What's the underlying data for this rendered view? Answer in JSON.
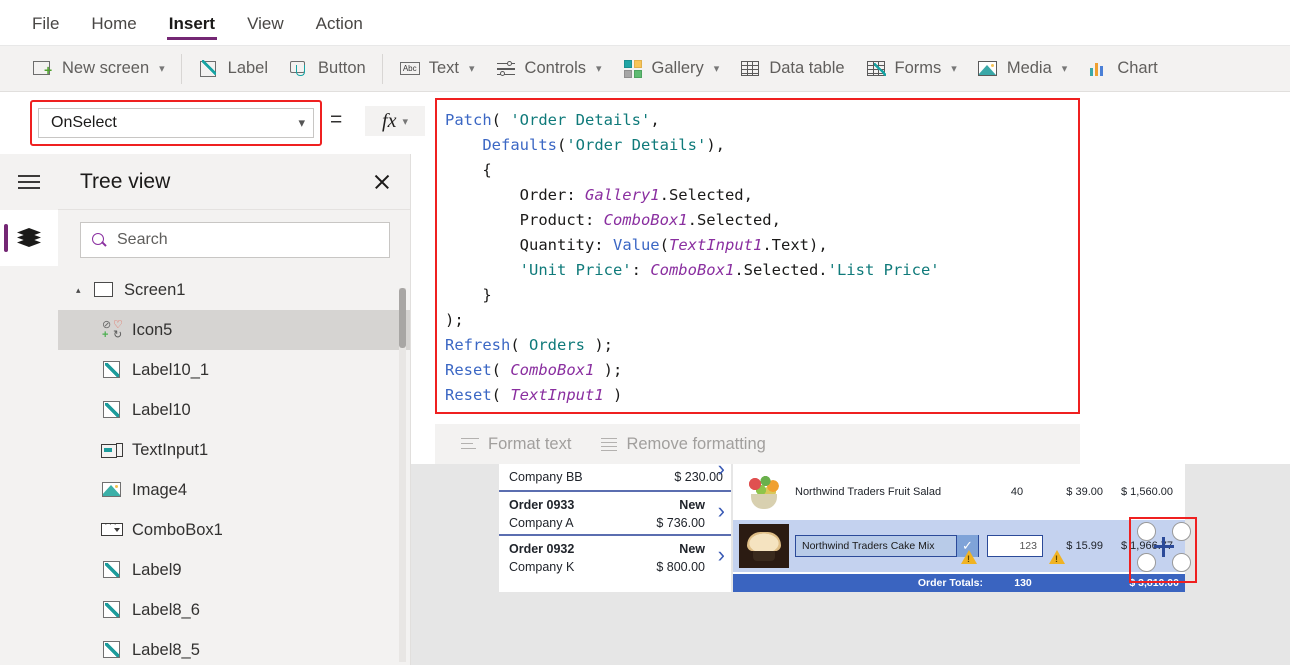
{
  "menu": {
    "items": [
      {
        "label": "File",
        "active": false
      },
      {
        "label": "Home",
        "active": false
      },
      {
        "label": "Insert",
        "active": true
      },
      {
        "label": "View",
        "active": false
      },
      {
        "label": "Action",
        "active": false
      }
    ]
  },
  "ribbon": {
    "items": [
      {
        "label": "New screen",
        "icon": "new-screen-icon",
        "chevron": true
      },
      {
        "label": "Label",
        "icon": "label-icon",
        "chevron": false
      },
      {
        "label": "Button",
        "icon": "button-icon",
        "chevron": false
      },
      {
        "label": "Text",
        "icon": "text-abc-icon",
        "chevron": true
      },
      {
        "label": "Controls",
        "icon": "controls-sliders-icon",
        "chevron": true
      },
      {
        "label": "Gallery",
        "icon": "gallery-icon",
        "chevron": true
      },
      {
        "label": "Data table",
        "icon": "data-table-icon",
        "chevron": false
      },
      {
        "label": "Forms",
        "icon": "forms-icon",
        "chevron": true
      },
      {
        "label": "Media",
        "icon": "media-image-icon",
        "chevron": true
      },
      {
        "label": "Chart",
        "icon": "chart-bar-icon",
        "chevron": false
      }
    ]
  },
  "property_bar": {
    "selected_property": "OnSelect",
    "equals": "=",
    "fx_label": "fx",
    "highlight_color": "#ef2020"
  },
  "formula": {
    "lines": [
      [
        {
          "t": "Patch",
          "c": "fn"
        },
        {
          "t": "( ",
          "c": "pun"
        },
        {
          "t": "'Order Details'",
          "c": "str"
        },
        {
          "t": ",",
          "c": "pun"
        }
      ],
      [
        {
          "t": "    ",
          "c": "pun"
        },
        {
          "t": "Defaults",
          "c": "fn"
        },
        {
          "t": "(",
          "c": "pun"
        },
        {
          "t": "'Order Details'",
          "c": "str"
        },
        {
          "t": "),",
          "c": "pun"
        }
      ],
      [
        {
          "t": "    {",
          "c": "pun"
        }
      ],
      [
        {
          "t": "        Order: ",
          "c": "id"
        },
        {
          "t": "Gallery1",
          "c": "var"
        },
        {
          "t": ".Selected,",
          "c": "id"
        }
      ],
      [
        {
          "t": "        Product: ",
          "c": "id"
        },
        {
          "t": "ComboBox1",
          "c": "var"
        },
        {
          "t": ".Selected,",
          "c": "id"
        }
      ],
      [
        {
          "t": "        Quantity: ",
          "c": "id"
        },
        {
          "t": "Value",
          "c": "fn"
        },
        {
          "t": "(",
          "c": "pun"
        },
        {
          "t": "TextInput1",
          "c": "var"
        },
        {
          "t": ".Text),",
          "c": "id"
        }
      ],
      [
        {
          "t": "        ",
          "c": "id"
        },
        {
          "t": "'Unit Price'",
          "c": "str"
        },
        {
          "t": ": ",
          "c": "id"
        },
        {
          "t": "ComboBox1",
          "c": "var"
        },
        {
          "t": ".Selected.",
          "c": "id"
        },
        {
          "t": "'List Price'",
          "c": "str"
        }
      ],
      [
        {
          "t": "    }",
          "c": "pun"
        }
      ],
      [
        {
          "t": ");",
          "c": "pun"
        }
      ],
      [
        {
          "t": "Refresh",
          "c": "fn"
        },
        {
          "t": "( ",
          "c": "pun"
        },
        {
          "t": "Orders",
          "c": "str"
        },
        {
          "t": " );",
          "c": "pun"
        }
      ],
      [
        {
          "t": "Reset",
          "c": "fn"
        },
        {
          "t": "( ",
          "c": "pun"
        },
        {
          "t": "ComboBox1",
          "c": "var"
        },
        {
          "t": " );",
          "c": "pun"
        }
      ],
      [
        {
          "t": "Reset",
          "c": "fn"
        },
        {
          "t": "( ",
          "c": "pun"
        },
        {
          "t": "TextInput1",
          "c": "var"
        },
        {
          "t": " )",
          "c": "pun"
        }
      ]
    ]
  },
  "format_bar": {
    "format_text": "Format text",
    "remove_formatting": "Remove formatting"
  },
  "tree_view": {
    "title": "Tree view",
    "search_placeholder": "Search",
    "items": [
      {
        "label": "Screen1",
        "icon": "screen-icon",
        "level": "root",
        "selected": false,
        "caret": "▴"
      },
      {
        "label": "Icon5",
        "icon": "icon5-icon",
        "level": "child",
        "selected": true
      },
      {
        "label": "Label10_1",
        "icon": "label-icon",
        "level": "child",
        "selected": false
      },
      {
        "label": "Label10",
        "icon": "label-icon",
        "level": "child",
        "selected": false
      },
      {
        "label": "TextInput1",
        "icon": "textinput-icon",
        "level": "child",
        "selected": false
      },
      {
        "label": "Image4",
        "icon": "image-icon",
        "level": "child",
        "selected": false
      },
      {
        "label": "ComboBox1",
        "icon": "combobox-icon",
        "level": "child",
        "selected": false
      },
      {
        "label": "Label9",
        "icon": "label-icon",
        "level": "child",
        "selected": false
      },
      {
        "label": "Label8_6",
        "icon": "label-icon",
        "level": "child",
        "selected": false
      },
      {
        "label": "Label8_5",
        "icon": "label-icon",
        "level": "child",
        "selected": false
      }
    ]
  },
  "canvas": {
    "order_list": [
      {
        "company": "Company BB",
        "amount": "$ 230.00",
        "partial": true
      },
      {
        "order": "Order 0933",
        "status": "New",
        "company": "Company A",
        "amount": "$ 736.00",
        "partial": false
      },
      {
        "order": "Order 0932",
        "status": "New",
        "company": "Company K",
        "amount": "$ 800.00",
        "partial": false
      }
    ],
    "detail_rows": [
      {
        "product": "Northwind Traders Fruit Salad",
        "quantity": "40",
        "unit_price": "$ 39.00",
        "total": "$ 1,560.00",
        "selected": false,
        "thumb": "salad-thumbnail"
      },
      {
        "product": "Northwind Traders Cake Mix",
        "quantity": "123",
        "unit_price": "$ 15.99",
        "total": "$ 1,966.77",
        "selected": true,
        "thumb": "cake-thumbnail"
      }
    ],
    "totals": {
      "label": "Order Totals:",
      "quantity": "130",
      "amount": "$ 3,810.00"
    }
  }
}
